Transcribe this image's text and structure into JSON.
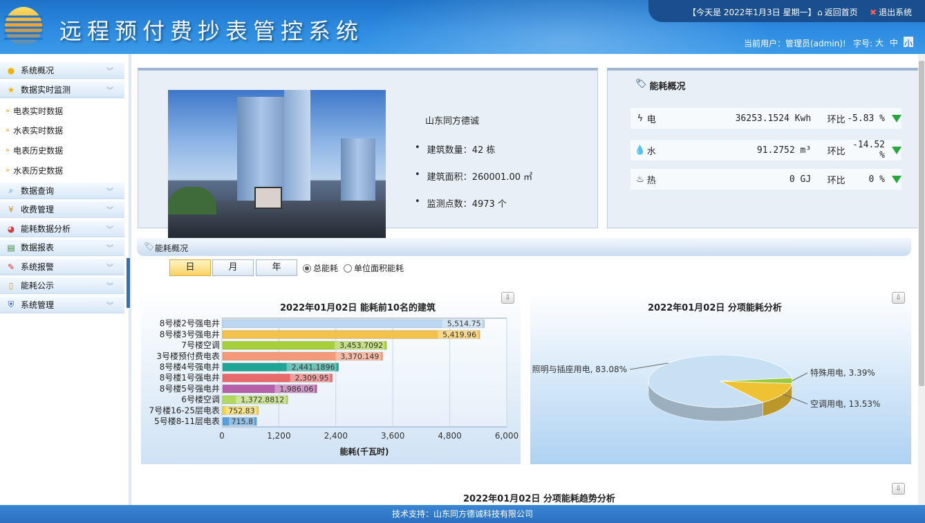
{
  "header": {
    "app_title": "远程预付费抄表管控系统",
    "date_text": "【今天是 2022年1月3日 星期一】",
    "home_link": "返回首页",
    "logout_link": "退出系统",
    "user_text": "当前用户：管理员(admin)!",
    "font_label": "字号:",
    "font_sizes": [
      "大",
      "中",
      "小"
    ],
    "font_active": "小"
  },
  "sidebar": {
    "menus": [
      {
        "label": "系统概况",
        "icon": "bulb-icon"
      },
      {
        "label": "数据实时监测",
        "icon": "star-icon"
      },
      {
        "label": "数据查询",
        "icon": "search-icon"
      },
      {
        "label": "收费管理",
        "icon": "money-icon"
      },
      {
        "label": "能耗数据分析",
        "icon": "pie-icon"
      },
      {
        "label": "数据报表",
        "icon": "report-icon"
      },
      {
        "label": "系统报警",
        "icon": "alarm-icon"
      },
      {
        "label": "能耗公示",
        "icon": "notice-icon"
      },
      {
        "label": "系统管理",
        "icon": "shield-icon"
      }
    ],
    "submenus": [
      "电表实时数据",
      "水表实时数据",
      "电表历史数据",
      "水表历史数据"
    ]
  },
  "overview": {
    "company": "山东同方德诚",
    "bullets": [
      {
        "label": "建筑数量：",
        "value": "42 栋"
      },
      {
        "label": "建筑面积：",
        "value": "260001.00 ㎡"
      },
      {
        "label": "监测点数：",
        "value": "4973 个"
      }
    ]
  },
  "energy_summary": {
    "title": "能耗概况",
    "rows": [
      {
        "icon": "bolt-icon",
        "name": "电",
        "value": "36253.1524 Kwh",
        "hb_label": "环比",
        "hb_value": "-5.83 %"
      },
      {
        "icon": "drop-icon",
        "name": "水",
        "value": "91.2752 m³",
        "hb_label": "环比",
        "hb_value": "-14.52 %"
      },
      {
        "icon": "heat-icon",
        "name": "热",
        "value": "0 GJ",
        "hb_label": "环比",
        "hb_value": "0 %"
      }
    ]
  },
  "section2": {
    "title": "能耗概况",
    "tabs": [
      "日",
      "月",
      "年"
    ],
    "active_tab": "日",
    "radios": [
      {
        "label": "总能耗",
        "checked": true
      },
      {
        "label": "单位面积能耗",
        "checked": false
      }
    ]
  },
  "chart_data": [
    {
      "type": "bar",
      "orientation": "horizontal",
      "title": "2022年01月02日 能耗前10名的建筑",
      "xlabel": "能耗(千瓦时)",
      "ylabel": "",
      "xlim": [
        0,
        6000
      ],
      "xticks": [
        "0",
        "1,200",
        "2,400",
        "3,600",
        "4,800",
        "6,000"
      ],
      "categories": [
        "8号楼2号强电井",
        "8号楼3号强电井",
        "7号楼空调",
        "3号楼预付费电表",
        "8号楼4号强电井",
        "8号楼1号强电井",
        "8号楼5号强电井",
        "6号楼空调",
        "7号楼16-25层电表",
        "5号楼8-11层电表"
      ],
      "values": [
        5514.75,
        5419.96,
        3453.7092,
        3370.149,
        2441.1896,
        2309.95,
        1986.06,
        1372.8812,
        752.83,
        715.8
      ],
      "labels": [
        "5,514.75",
        "5,419.96",
        "3,453.7092",
        "3,370.149",
        "2,441.1896",
        "2,309.95",
        "1,986.06",
        "1,372.8812",
        "752.83",
        "715.8"
      ],
      "colors": [
        "#bcd7f2",
        "#f3c24a",
        "#a6cf3a",
        "#f49a78",
        "#1ea596",
        "#e86a6a",
        "#b560a8",
        "#b2d860",
        "#f0d44a",
        "#5aa0d8"
      ],
      "grid": true
    },
    {
      "type": "pie",
      "title": "2022年01月02日 分项能耗分析",
      "slices": [
        {
          "name": "照明与插座用电",
          "value": 83.08,
          "label": "照明与插座用电, 83.08%",
          "color": "#c7e0f4"
        },
        {
          "name": "特殊用电",
          "value": 3.39,
          "label": "特殊用电, 3.39%",
          "color": "#9ec93a"
        },
        {
          "name": "空调用电",
          "value": 13.53,
          "label": "空调用电, 13.53%",
          "color": "#efc233"
        }
      ]
    },
    {
      "type": "line",
      "title": "2022年01月02日 分项能耗趋势分析"
    }
  ],
  "footer": {
    "text": "技术支持：山东同方德诚科技有限公司"
  }
}
